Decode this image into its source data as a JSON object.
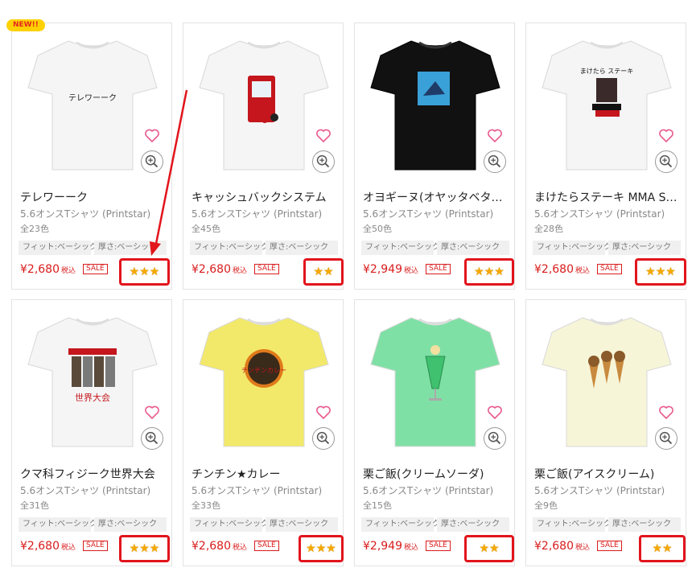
{
  "colors": {
    "price": "#d91c1c",
    "highlight": "#e2141c",
    "star": "#f5a900",
    "badge_bg": "#ffd100"
  },
  "new_badge": "NEW!!",
  "products": [
    {
      "title": "テレワーーク",
      "subtitle": "5.6オンスTシャツ (Printstar)",
      "colors": "全23色",
      "fit": "フィット:ベーシック",
      "thickness": "厚さ:ベーシック",
      "price": "¥2,680",
      "tax": "税込",
      "sale": "SALE",
      "stars": 3,
      "shirt_color": "#f5f5f5",
      "print": "テレワーーク"
    },
    {
      "title": "キャッシュバックシステム",
      "subtitle": "5.6オンスTシャツ (Printstar)",
      "colors": "全45色",
      "fit": "フィット:ベーシック",
      "thickness": "厚さ:ベーシック",
      "price": "¥2,680",
      "tax": "税込",
      "sale": "SALE",
      "stars": 2,
      "shirt_color": "#f5f5f5",
      "print": ""
    },
    {
      "title": "オヨギーヌ(オヤッタベタ…",
      "subtitle": "5.6オンスTシャツ (Printstar)",
      "colors": "全50色",
      "fit": "フィット:ベーシック",
      "thickness": "厚さ:ベーシック",
      "price": "¥2,949",
      "tax": "税込",
      "sale": "SALE",
      "stars": 3,
      "shirt_color": "#111111",
      "print": ""
    },
    {
      "title": "まけたらステーキ MMA S…",
      "subtitle": "5.6オンスTシャツ (Printstar)",
      "colors": "全28色",
      "fit": "フィット:ベーシック",
      "thickness": "厚さ:ベーシック",
      "price": "¥2,680",
      "tax": "税込",
      "sale": "SALE",
      "stars": 3,
      "shirt_color": "#f5f5f5",
      "print": "まけたら ステーキ"
    },
    {
      "title": "クマ科フィジーク世界大会",
      "subtitle": "5.6オンスTシャツ (Printstar)",
      "colors": "全31色",
      "fit": "フィット:ベーシック",
      "thickness": "厚さ:ベーシック",
      "price": "¥2,680",
      "tax": "税込",
      "sale": "SALE",
      "stars": 3,
      "shirt_color": "#f5f5f5",
      "print": "世界大会"
    },
    {
      "title": "チンチン★カレー",
      "subtitle": "5.6オンスTシャツ (Printstar)",
      "colors": "全33色",
      "fit": "フィット:ベーシック",
      "thickness": "厚さ:ベーシック",
      "price": "¥2,680",
      "tax": "税込",
      "sale": "SALE",
      "stars": 3,
      "shirt_color": "#f2e96a",
      "print": "チンチンカレー"
    },
    {
      "title": "栗ご飯(クリームソーダ)",
      "subtitle": "5.6オンスTシャツ (Printstar)",
      "colors": "全15色",
      "fit": "フィット:ベーシック",
      "thickness": "厚さ:ベーシック",
      "price": "¥2,949",
      "tax": "税込",
      "sale": "SALE",
      "stars": 2,
      "shirt_color": "#7fe0a5",
      "print": ""
    },
    {
      "title": "栗ご飯(アイスクリーム)",
      "subtitle": "5.6オンスTシャツ (Printstar)",
      "colors": "全9色",
      "fit": "フィット:ベーシック",
      "thickness": "厚さ:ベーシック",
      "price": "¥2,680",
      "tax": "税込",
      "sale": "SALE",
      "stars": 2,
      "shirt_color": "#f7f5d8",
      "print": ""
    }
  ]
}
